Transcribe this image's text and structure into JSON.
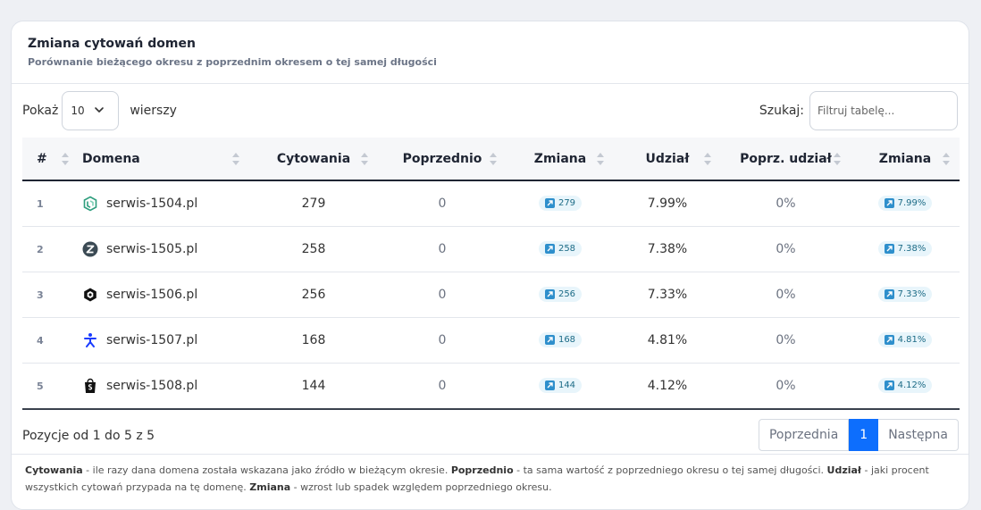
{
  "header": {
    "title": "Zmiana cytowań domen",
    "subtitle": "Porównanie bieżącego okresu z poprzednim okresem o tej samej długości"
  },
  "controls": {
    "show_label": "Pokaż",
    "page_length": "10",
    "rows_label": "wierszy",
    "search_label": "Szukaj:",
    "search_placeholder": "Filtruj tabelę..."
  },
  "table": {
    "columns": [
      "#",
      "Domena",
      "Cytowania",
      "Poprzednio",
      "Zmiana",
      "Udział",
      "Poprz. udział",
      "Zmiana"
    ],
    "rows": [
      {
        "num": "1",
        "domain": "serwis-1504.pl",
        "icon": "hex-logo-icon",
        "citations": "279",
        "previous": "0",
        "change": "279",
        "share": "7.99%",
        "prev_share": "0%",
        "share_change": "7.99%"
      },
      {
        "num": "2",
        "domain": "serwis-1505.pl",
        "icon": "z-logo-icon",
        "citations": "258",
        "previous": "0",
        "change": "258",
        "share": "7.38%",
        "prev_share": "0%",
        "share_change": "7.38%"
      },
      {
        "num": "3",
        "domain": "serwis-1506.pl",
        "icon": "lion-logo-icon",
        "citations": "256",
        "previous": "0",
        "change": "256",
        "share": "7.33%",
        "prev_share": "0%",
        "share_change": "7.33%"
      },
      {
        "num": "4",
        "domain": "serwis-1507.pl",
        "icon": "person-logo-icon",
        "citations": "168",
        "previous": "0",
        "change": "168",
        "share": "4.81%",
        "prev_share": "0%",
        "share_change": "4.81%"
      },
      {
        "num": "5",
        "domain": "serwis-1508.pl",
        "icon": "bag-logo-icon",
        "citations": "144",
        "previous": "0",
        "change": "144",
        "share": "4.12%",
        "prev_share": "0%",
        "share_change": "4.12%"
      }
    ]
  },
  "footer": {
    "info": "Pozycje od 1 do 5 z 5",
    "prev_label": "Poprzednia",
    "current_page": "1",
    "next_label": "Następna"
  },
  "note": {
    "t1": "Cytowania",
    "d1": " - ile razy dana domena została wskazana jako źródło w bieżącym okresie. ",
    "t2": "Poprzednio",
    "d2": " - ta sama wartość z poprzedniego okresu o tej samej długości. ",
    "t3": "Udział",
    "d3": " - jaki procent wszystkich cytowań przypada na tę domenę. ",
    "t4": "Zmiana",
    "d4": " - wzrost lub spadek względem poprzedniego okresu."
  },
  "colors": {
    "accent": "#0d6efd",
    "badge_bg": "#e8f5fb",
    "badge_text": "#1c6b86"
  }
}
